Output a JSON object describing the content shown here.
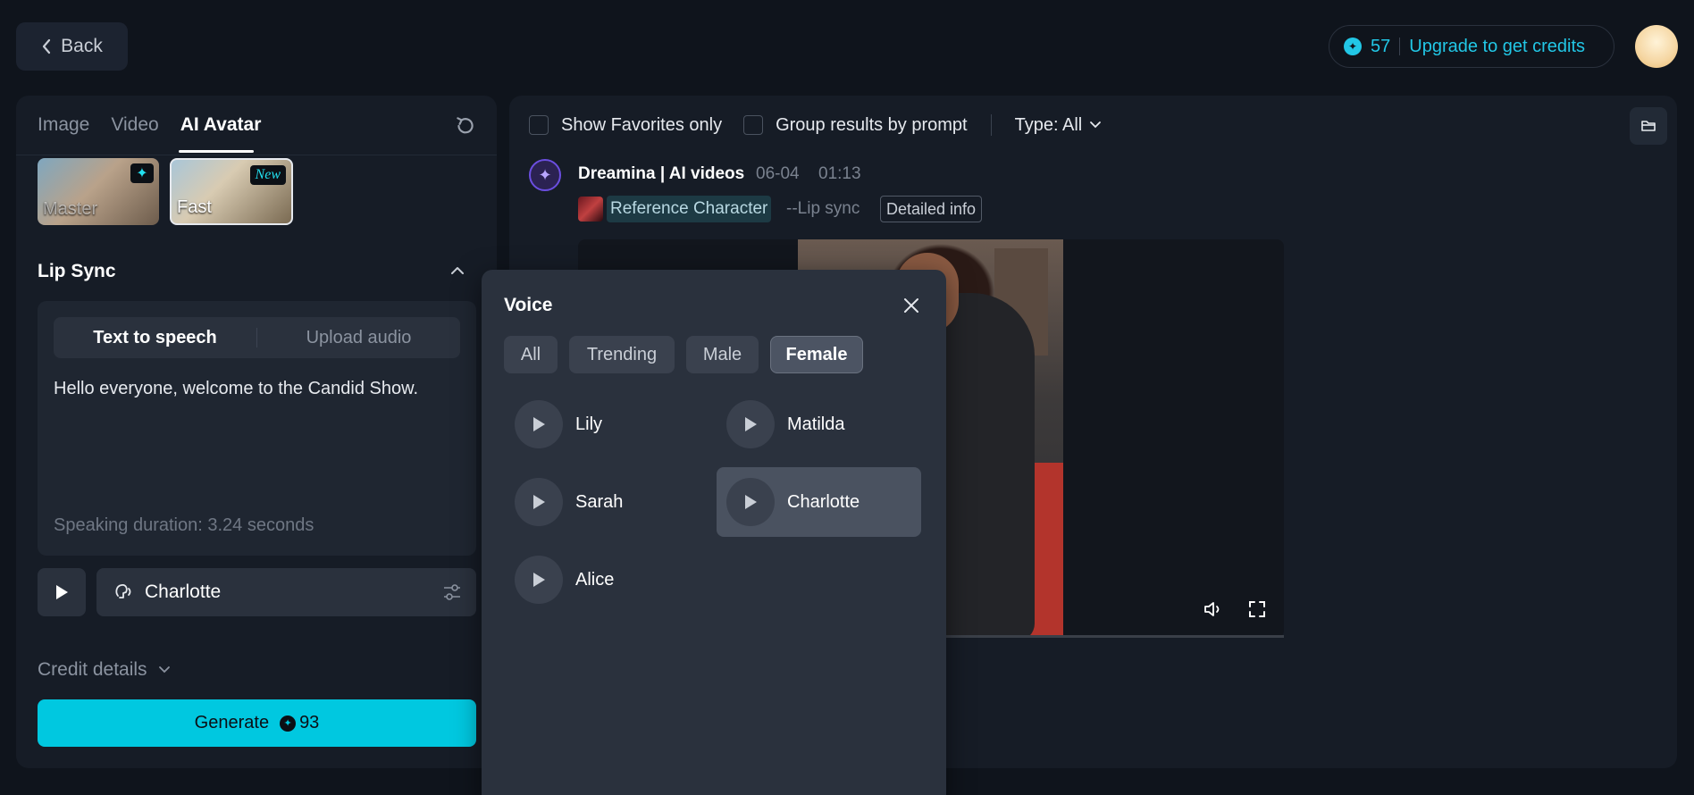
{
  "header": {
    "back_label": "Back",
    "credits_count": "57",
    "upgrade_label": "Upgrade to get credits"
  },
  "left_panel": {
    "tabs": [
      {
        "label": "Image"
      },
      {
        "label": "Video"
      },
      {
        "label": "AI Avatar"
      }
    ],
    "active_tab": "AI Avatar",
    "models": [
      {
        "label": "Master",
        "badge": "✦"
      },
      {
        "label": "Fast",
        "badge": "New"
      }
    ],
    "lip_sync_title": "Lip Sync",
    "mode_tabs": [
      {
        "label": "Text to speech"
      },
      {
        "label": "Upload audio"
      }
    ],
    "speech_text": "Hello everyone, welcome to the Candid Show.",
    "duration_text": "Speaking duration: 3.24 seconds",
    "selected_voice": "Charlotte",
    "credit_details_label": "Credit details",
    "generate_label": "Generate",
    "generate_cost": "93"
  },
  "toolbar": {
    "favorites_label": "Show Favorites only",
    "group_label": "Group results by prompt",
    "type_label": "Type: All"
  },
  "generation": {
    "title": "Dreamina | AI videos",
    "date": "06-04",
    "time": "01:13",
    "reference_label": "Reference Character",
    "lip_sync_tag": "--Lip sync",
    "detail_label": "Detailed info"
  },
  "voice_popup": {
    "title": "Voice",
    "filters": [
      {
        "label": "All"
      },
      {
        "label": "Trending"
      },
      {
        "label": "Male"
      },
      {
        "label": "Female"
      }
    ],
    "active_filter": "Female",
    "voices": [
      {
        "name": "Lily"
      },
      {
        "name": "Matilda"
      },
      {
        "name": "Sarah"
      },
      {
        "name": "Charlotte"
      },
      {
        "name": "Alice"
      }
    ],
    "selected_voice": "Charlotte"
  },
  "colors": {
    "accent": "#00c8e0",
    "background": "#0f141c",
    "panel": "#161c26"
  }
}
